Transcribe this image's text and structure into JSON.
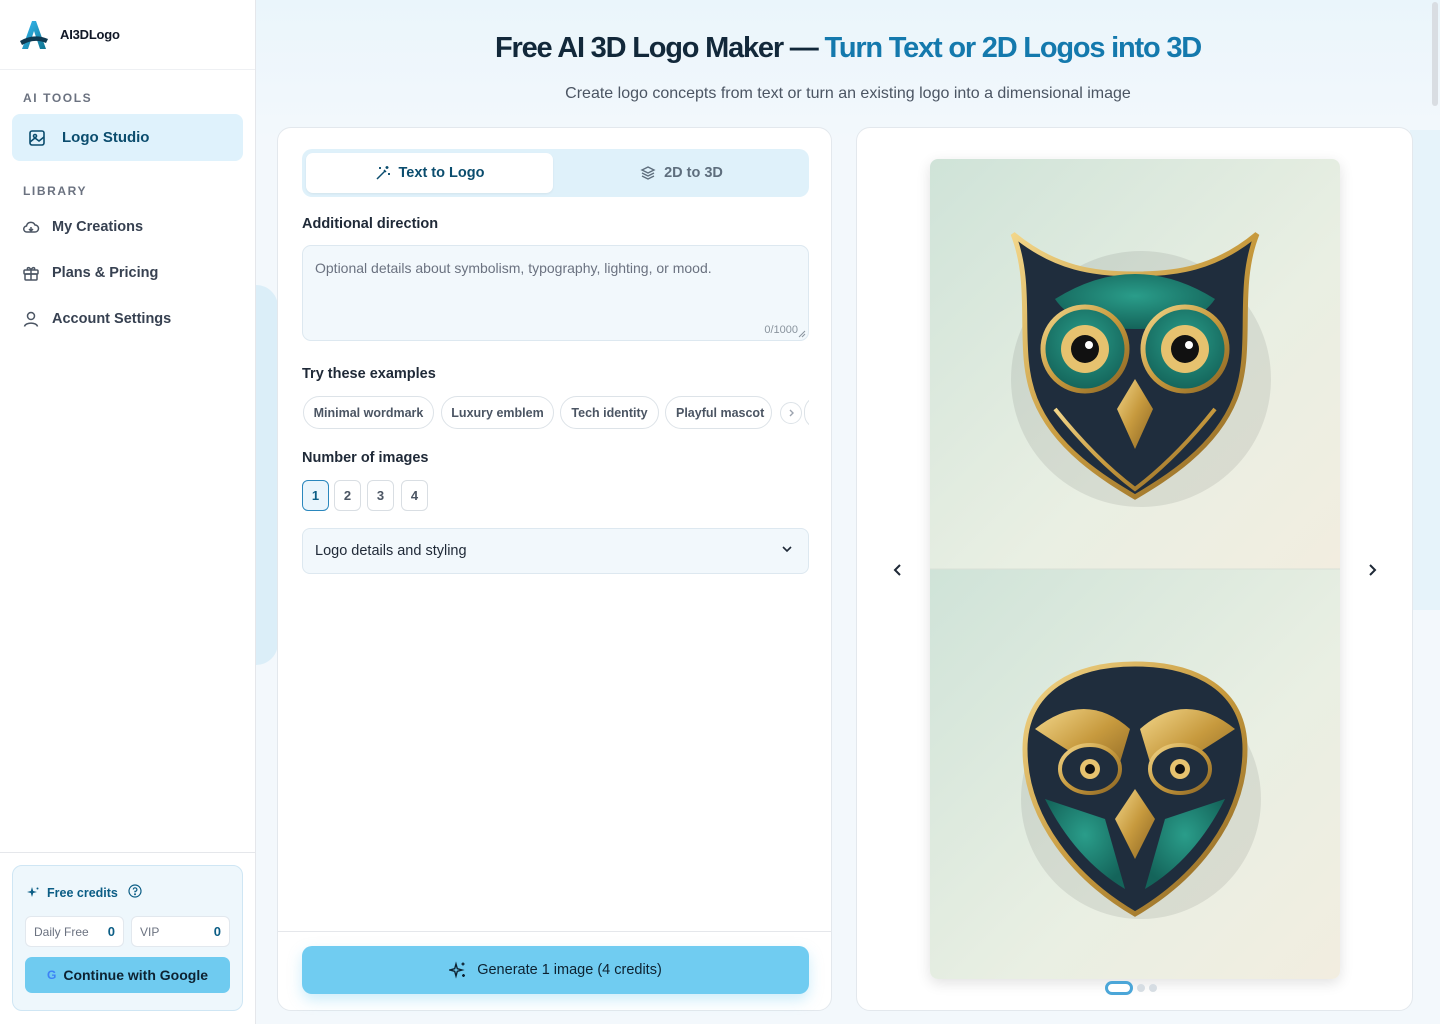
{
  "app": {
    "brand_name": "AI3DLogo"
  },
  "sidebar": {
    "section_ai_tools": "AI TOOLS",
    "active_item": {
      "label": "Logo Studio",
      "icon": "image-icon"
    },
    "section_library": "LIBRARY",
    "items": [
      {
        "label": "My Creations",
        "icon": "cloud-icon"
      },
      {
        "label": "Plans & Pricing",
        "icon": "gift-icon"
      },
      {
        "label": "Account Settings",
        "icon": "user-icon"
      }
    ],
    "credits": {
      "title": "Free credits",
      "daily_label": "Daily Free",
      "daily_value": "0",
      "vip_label": "VIP",
      "vip_value": "0",
      "google_button": "Continue with Google",
      "google_glyph": "G"
    }
  },
  "header": {
    "title_main": "Free AI 3D Logo Maker — ",
    "title_accent": "Turn Text or 2D Logos into 3D",
    "subtitle": "Create logo concepts from text or turn an existing logo into a dimensional image"
  },
  "form": {
    "tabs": [
      {
        "label": "Text to Logo",
        "active": true
      },
      {
        "label": "2D to 3D",
        "active": false
      }
    ],
    "direction_label": "Additional direction",
    "direction_placeholder": "Optional details about symbolism, typography, lighting, or mood.",
    "direction_counter": "0/1000",
    "examples_label": "Try these examples",
    "examples": [
      "Minimal wordmark",
      "Luxury emblem",
      "Tech identity",
      "Playful mascot"
    ],
    "count_label": "Number of images",
    "count_options": [
      "1",
      "2",
      "3",
      "4"
    ],
    "count_selected": "1",
    "accordion_label": "Logo details and styling",
    "generate_label": "Generate 1 image (4 credits)"
  },
  "preview": {
    "slide_count": 3,
    "active_slide": 1
  },
  "colors": {
    "accent": "#1479ad",
    "button": "#70ccf1",
    "active_nav_bg": "#dff2fc"
  }
}
